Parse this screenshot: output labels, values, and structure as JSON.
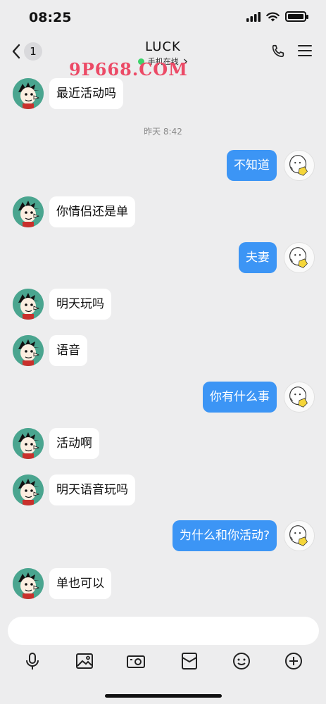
{
  "status_bar": {
    "time": "08:25"
  },
  "header": {
    "back_count": "1",
    "title": "LUCK",
    "subtitle": "手机在线",
    "watermark": "9P668.COM"
  },
  "time_divider": "昨天 8:42",
  "messages": [
    {
      "side": "left",
      "text": "最近活动吗"
    },
    {
      "side": "right",
      "text": "不知道"
    },
    {
      "side": "left",
      "text": "你情侣还是单"
    },
    {
      "side": "right",
      "text": "夫妻"
    },
    {
      "side": "left",
      "text": "明天玩吗"
    },
    {
      "side": "left",
      "text": "语音"
    },
    {
      "side": "right",
      "text": "你有什么事"
    },
    {
      "side": "left",
      "text": "活动啊"
    },
    {
      "side": "left",
      "text": "明天语音玩吗"
    },
    {
      "side": "right",
      "text": "为什么和你活动?"
    },
    {
      "side": "left",
      "text": "单也可以"
    }
  ],
  "toolbar": [
    "microphone-icon",
    "image-icon",
    "camera-icon",
    "red-packet-icon",
    "emoji-icon",
    "plus-icon"
  ],
  "colors": {
    "bubble_self": "#3c95f5",
    "bubble_other": "#ffffff",
    "background": "#ededee",
    "online": "#3dd36a"
  }
}
